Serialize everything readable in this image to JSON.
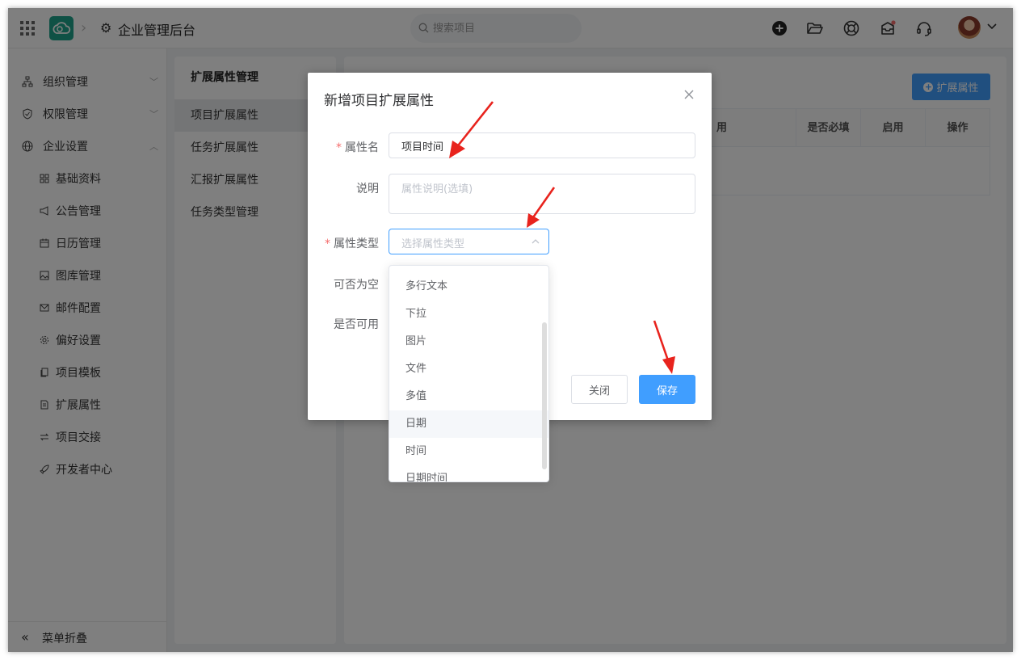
{
  "app": {
    "title": "企业管理后台",
    "search_placeholder": "搜索项目"
  },
  "sidebar": {
    "items": [
      {
        "label": "组织管理",
        "icon": "org-chart-icon",
        "arrow": "chevron-down"
      },
      {
        "label": "权限管理",
        "icon": "shield-check-icon",
        "arrow": "chevron-down"
      },
      {
        "label": "企业设置",
        "icon": "globe-icon",
        "arrow": "chevron-up"
      }
    ],
    "sub_items": [
      {
        "label": "基础资料",
        "icon": "grid-icon"
      },
      {
        "label": "公告管理",
        "icon": "megaphone-icon"
      },
      {
        "label": "日历管理",
        "icon": "calendar-icon"
      },
      {
        "label": "图库管理",
        "icon": "image-icon"
      },
      {
        "label": "邮件配置",
        "icon": "mail-icon"
      },
      {
        "label": "偏好设置",
        "icon": "gear-icon"
      },
      {
        "label": "项目模板",
        "icon": "copy-icon"
      },
      {
        "label": "扩展属性",
        "icon": "document-icon"
      },
      {
        "label": "项目交接",
        "icon": "swap-icon"
      },
      {
        "label": "开发者中心",
        "icon": "rocket-icon"
      }
    ],
    "collapse_label": "菜单折叠"
  },
  "subpanel": {
    "title": "扩展属性管理",
    "items": [
      "项目扩展属性",
      "任务扩展属性",
      "汇报扩展属性",
      "任务类型管理"
    ],
    "active_index": 0
  },
  "main": {
    "add_button": "扩展属性",
    "columns": [
      "用",
      "是否必填",
      "启用",
      "操作"
    ]
  },
  "dialog": {
    "title": "新增项目扩展属性",
    "fields": {
      "name_label": "属性名",
      "name_value": "项目时间",
      "desc_label": "说明",
      "desc_placeholder": "属性说明(选填)",
      "type_label": "属性类型",
      "type_placeholder": "选择属性类型",
      "nullable_label": "可否为空",
      "enabled_label": "是否可用"
    },
    "close_button": "关闭",
    "save_button": "保存"
  },
  "dropdown": {
    "options": [
      "多行文本",
      "下拉",
      "图片",
      "文件",
      "多值",
      "日期",
      "时间",
      "日期时间"
    ],
    "hovered_index": 5
  },
  "colors": {
    "primary": "#409eff",
    "brand": "#1fa38a",
    "required": "#f56c6c",
    "annotation_arrow": "#e8231d"
  }
}
